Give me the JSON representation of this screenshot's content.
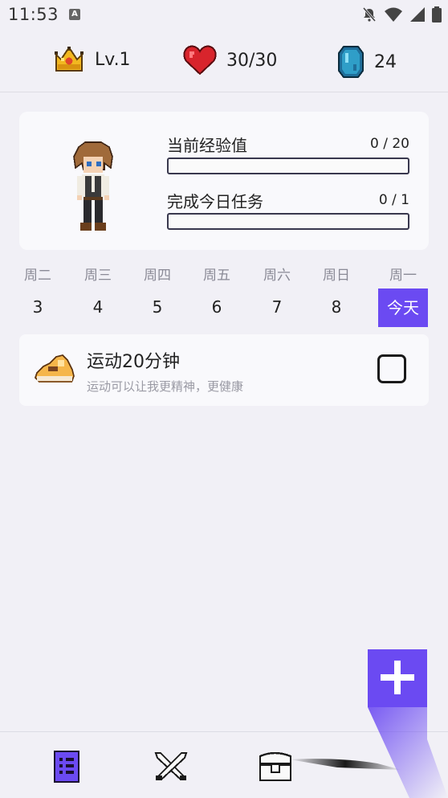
{
  "status_bar": {
    "time": "11:53",
    "badge": "A",
    "icons": [
      "bell-off-icon",
      "wifi-icon",
      "signal-icon",
      "battery-icon"
    ]
  },
  "stats": {
    "level": "Lv.1",
    "health": "30/30",
    "gems": "24"
  },
  "profile": {
    "exp_label": "当前经验值",
    "exp_value": "0 / 20",
    "exp_progress": 0,
    "tasks_label": "完成今日任务",
    "tasks_value": "0 / 1",
    "tasks_progress": 0
  },
  "week": {
    "days": [
      {
        "name": "周二",
        "num": "3"
      },
      {
        "name": "周三",
        "num": "4"
      },
      {
        "name": "周四",
        "num": "5"
      },
      {
        "name": "周五",
        "num": "6"
      },
      {
        "name": "周六",
        "num": "7"
      },
      {
        "name": "周日",
        "num": "8"
      },
      {
        "name": "周一",
        "num": "今天"
      }
    ]
  },
  "tasks": [
    {
      "title": "运动20分钟",
      "description": "运动可以让我更精神，更健康",
      "checked": false
    }
  ],
  "colors": {
    "accent": "#6b4af2",
    "background": "#f1f0f6",
    "card": "#f9f9fc"
  }
}
